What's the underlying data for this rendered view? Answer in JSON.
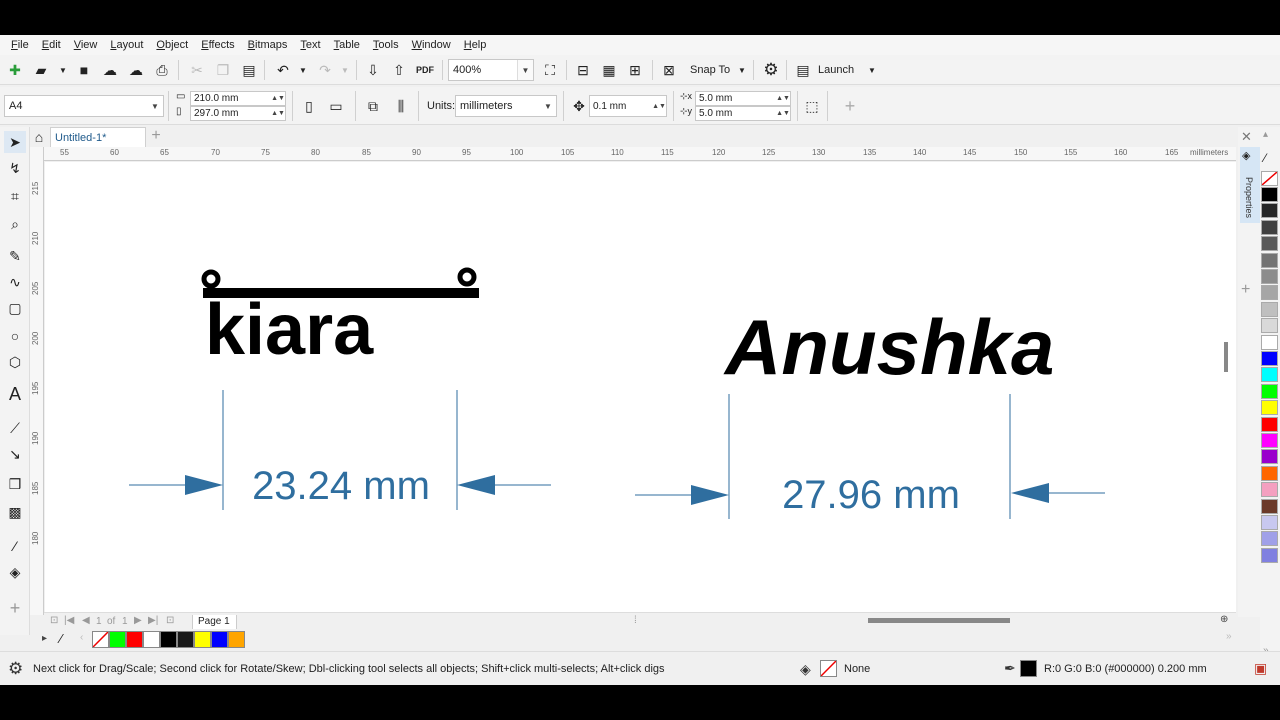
{
  "menu": [
    "File",
    "Edit",
    "View",
    "Layout",
    "Object",
    "Effects",
    "Bitmaps",
    "Text",
    "Table",
    "Tools",
    "Window",
    "Help"
  ],
  "toolbar": {
    "zoom": "400%",
    "pdf_label": "PDF",
    "snap_to": "Snap To",
    "launch": "Launch"
  },
  "property_bar": {
    "page_size": "A4",
    "width": "210.0 mm",
    "height": "297.0 mm",
    "units_label": "Units:",
    "units": "millimeters",
    "nudge": "0.1 mm",
    "dup_x": "5.0 mm",
    "dup_y": "5.0 mm"
  },
  "document": {
    "tab": "Untitled-1*"
  },
  "ruler": {
    "h_ticks": [
      "55",
      "60",
      "65",
      "70",
      "75",
      "80",
      "85",
      "90",
      "95",
      "100",
      "105",
      "110",
      "115",
      "120",
      "125",
      "130",
      "135",
      "140",
      "145",
      "150",
      "155",
      "160",
      "165"
    ],
    "unit": "millimeters",
    "v_ticks": [
      "215",
      "210",
      "205",
      "200",
      "195",
      "190",
      "185",
      "180"
    ]
  },
  "canvas": {
    "left_name": "kiara",
    "right_name": "Anushka",
    "left_measure": "23.24 mm",
    "right_measure": "27.96 mm",
    "measure_color": "#2f6e9f"
  },
  "pager": {
    "current": "1",
    "of": "of",
    "total": "1",
    "page_label": "Page 1"
  },
  "docker": {
    "label": "Properties"
  },
  "palette": {
    "bottom_swatches": [
      "#00ff00",
      "#ff0000",
      "#ffffff",
      "#000000",
      "#1a1a1a",
      "#ffff00",
      "#0000ff",
      "#ffa500"
    ],
    "right_swatches": [
      "#000000",
      "#262626",
      "#404040",
      "#595959",
      "#737373",
      "#8c8c8c",
      "#a6a6a6",
      "#bfbfbf",
      "#d9d9d9",
      "#ffffff",
      "#0000ff",
      "#00ffff",
      "#00ff00",
      "#ffff00",
      "#ff0000",
      "#ff00ff",
      "#9900cc",
      "#ff6600",
      "#f4a0c0",
      "#6b3a2a",
      "#c8c8f0",
      "#a0a0e8",
      "#8080e0"
    ]
  },
  "status": {
    "hint": "Next click for Drag/Scale; Second click for Rotate/Skew; Dbl-clicking tool selects all objects; Shift+click multi-selects; Alt+click digs",
    "fill": "None",
    "outline": "R:0 G:0 B:0 (#000000)  0.200 mm"
  }
}
